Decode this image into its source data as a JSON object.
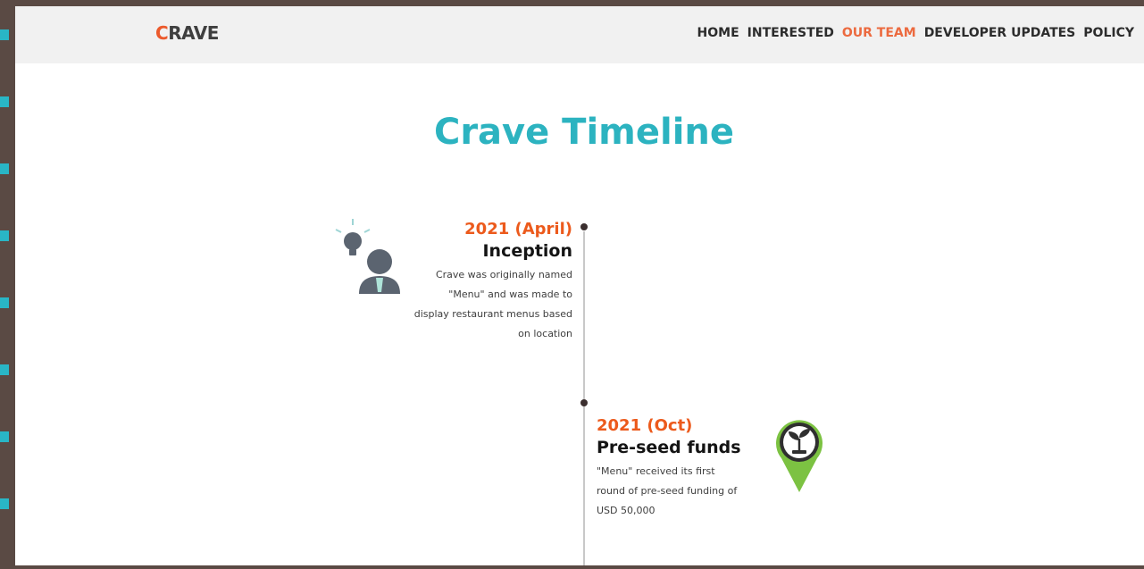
{
  "header": {
    "logo_first": "C",
    "logo_rest": "RAVE",
    "nav": [
      {
        "label": "HOME",
        "active": false
      },
      {
        "label": "INTERESTED",
        "active": false
      },
      {
        "label": "OUR TEAM",
        "active": true
      },
      {
        "label": "DEVELOPER UPDATES",
        "active": false
      },
      {
        "label": "POLICY",
        "active": false
      }
    ]
  },
  "main": {
    "title": "Crave Timeline",
    "timeline": [
      {
        "year": "2021 (April)",
        "title": "Inception",
        "description": "Crave was originally named \"Menu\" and was made to display restaurant menus based on location",
        "icon": "idea-person-icon"
      },
      {
        "year": "2021 (Oct)",
        "title": "Pre-seed funds",
        "description": "\"Menu\" received its first round of pre-seed funding of USD 50,000",
        "icon": "plant-pin-icon"
      }
    ]
  },
  "colors": {
    "accent_teal": "#2cb3c0",
    "accent_orange": "#ec5a1c",
    "nav_active": "#ec6a3f",
    "frame": "#5a4a44"
  }
}
